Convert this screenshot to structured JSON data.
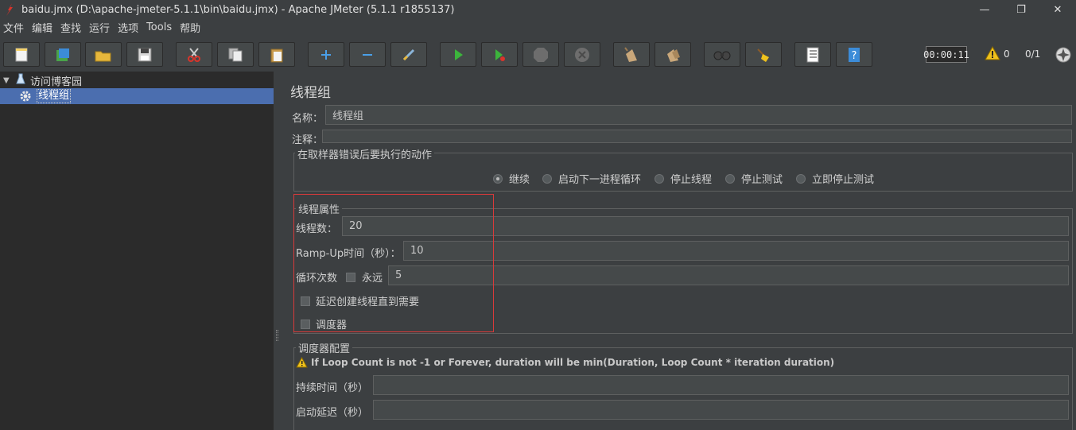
{
  "window": {
    "title": "baidu.jmx (D:\\apache-jmeter-5.1.1\\bin\\baidu.jmx) - Apache JMeter (5.1.1 r1855137)",
    "minimize": "—",
    "maximize": "❐",
    "close": "✕"
  },
  "menu": [
    "文件",
    "编辑",
    "查找",
    "运行",
    "选项",
    "Tools",
    "帮助"
  ],
  "toolbar": {
    "timer": "00:00:11",
    "warnings": "0",
    "threads": "0/1",
    "buttons": [
      "new-icon",
      "templates-icon",
      "open-icon",
      "save-icon",
      "cut-icon",
      "copy-icon",
      "paste-icon",
      "expand-icon",
      "collapse-icon",
      "toggle-icon",
      "start-icon",
      "start-no-pause-icon",
      "stop-icon",
      "shutdown-icon",
      "clear-icon",
      "clear-all-icon",
      "search-icon",
      "reset-search-icon",
      "function-helper-icon",
      "help-icon"
    ]
  },
  "tree": {
    "root": "访问博客园",
    "child": "线程组"
  },
  "panel": {
    "title": "线程组",
    "name_label": "名称：",
    "name_value": "线程组",
    "comment_label": "注释：",
    "comment_value": "",
    "error_action": {
      "title": "在取样器错误后要执行的动作",
      "options": [
        "继续",
        "启动下一进程循环",
        "停止线程",
        "停止测试",
        "立即停止测试"
      ],
      "selected": 0
    },
    "thread_props": {
      "title": "线程属性",
      "threads_label": "线程数：",
      "threads_value": "20",
      "rampup_label": "Ramp-Up时间（秒）：",
      "rampup_value": "10",
      "loop_label": "循环次数",
      "forever_label": "永远",
      "loop_value": "5",
      "delay_label": "延迟创建线程直到需要",
      "scheduler_label": "调度器"
    },
    "scheduler_config": {
      "title": "调度器配置",
      "warning": "If Loop Count is not -1 or Forever, duration will be min(Duration, Loop Count * iteration duration)",
      "duration_label": "持续时间（秒）",
      "duration_value": "",
      "delay_label": "启动延迟（秒）",
      "delay_value": ""
    }
  },
  "colors": {
    "background": "#3c3f41",
    "tree_background": "#2b2b2b",
    "selection": "#4b6eaf",
    "highlight": "#d93a3a"
  }
}
